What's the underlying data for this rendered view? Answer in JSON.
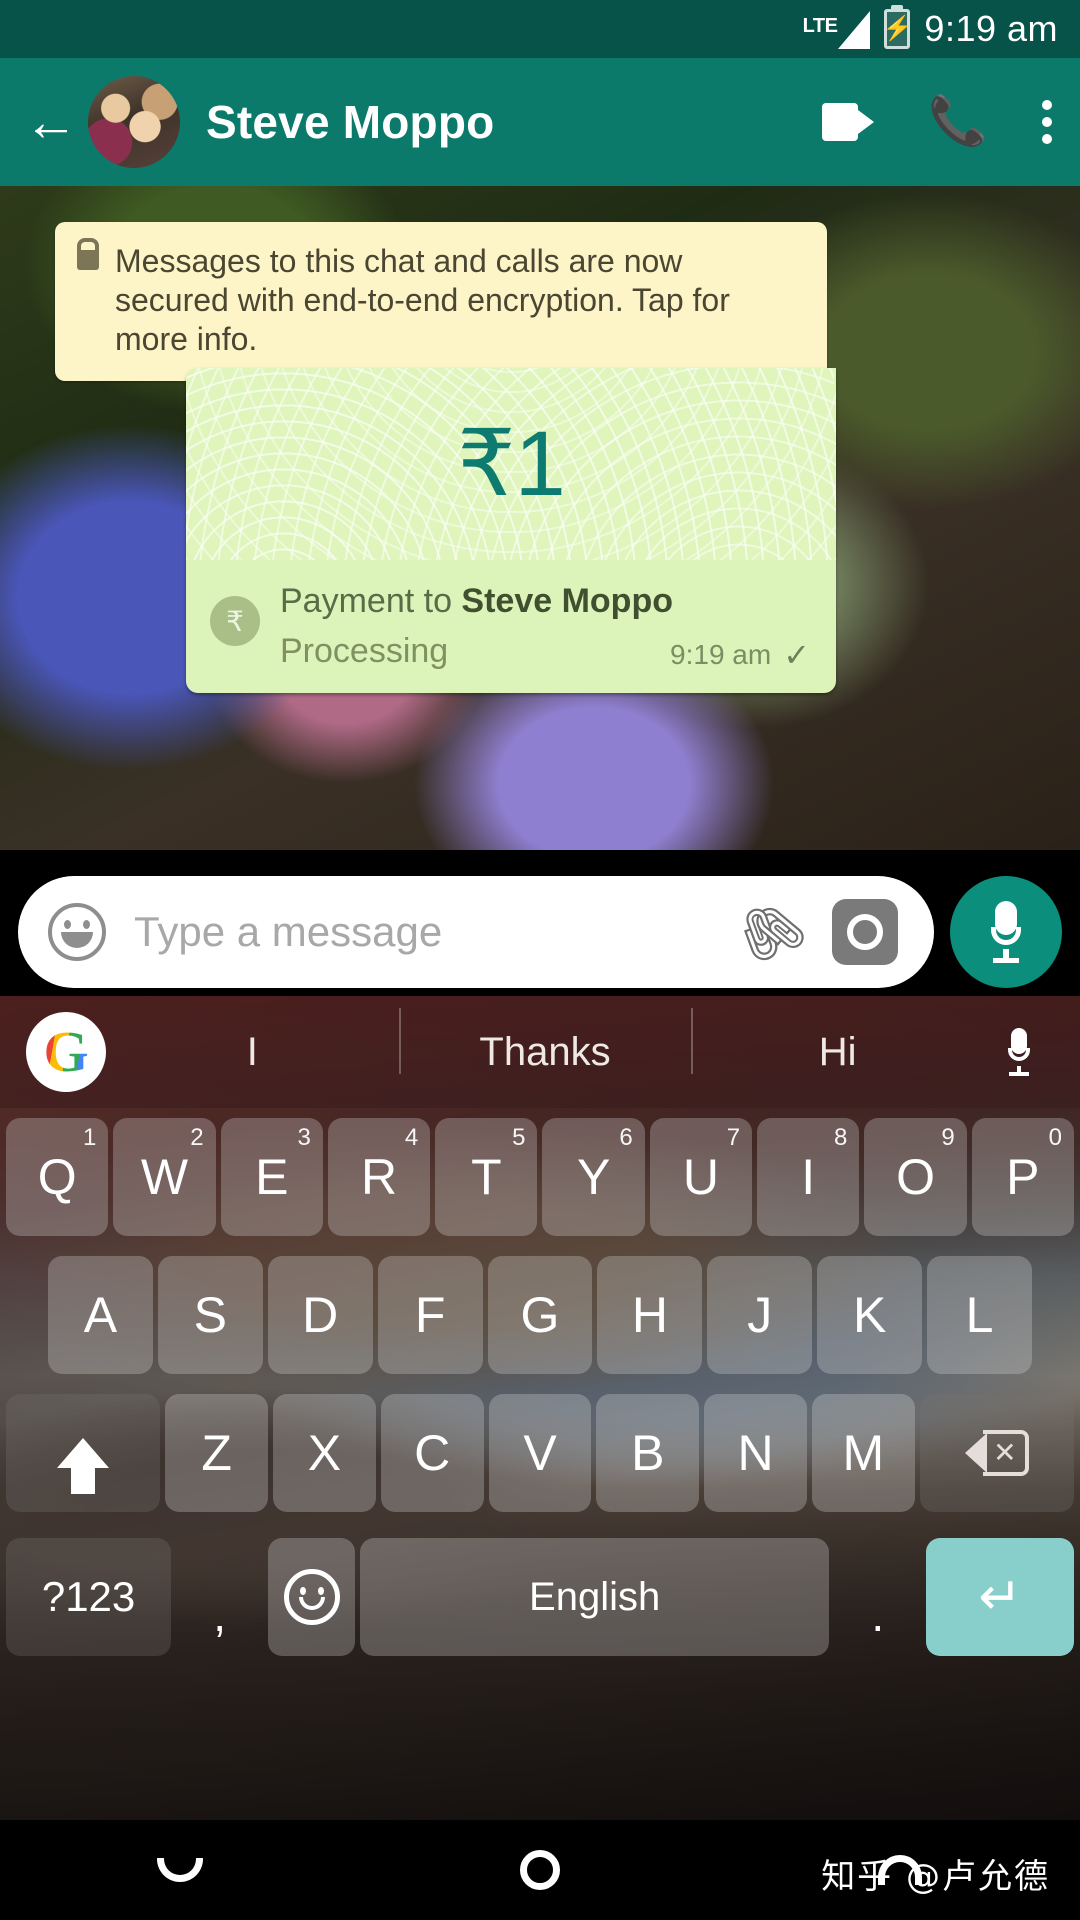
{
  "status_bar": {
    "network_label": "LTE",
    "signal_icon": "signal-bars-icon",
    "battery_icon": "battery-charging-icon",
    "time": "9:19 am"
  },
  "app_bar": {
    "back_icon": "back-arrow-icon",
    "avatar_alt": "contact-avatar",
    "contact_name": "Steve Moppo",
    "video_call_icon": "video-call-icon",
    "voice_call_icon": "phone-call-icon",
    "overflow_icon": "more-options-icon"
  },
  "chat": {
    "encryption_notice": {
      "lock_icon": "lock-icon",
      "text": "Messages to this chat and calls are now secured with end-to-end encryption. Tap for more info."
    },
    "payment_message": {
      "amount": "₹1",
      "currency_symbol": "₹",
      "value": "1",
      "badge_icon": "rupee-badge-icon",
      "title_prefix": "Payment to ",
      "recipient": "Steve Moppo",
      "status": "Processing",
      "timestamp": "9:19 am",
      "delivery_icon": "single-check-icon",
      "delivery_glyph": "✓",
      "accent_color": "#0d7b6f",
      "bubble_color": "#dcf4b9"
    }
  },
  "input_bar": {
    "emoji_icon": "emoji-icon",
    "placeholder": "Type a message",
    "value": "",
    "attach_icon": "paperclip-icon",
    "attach_glyph": "📎",
    "camera_icon": "camera-icon",
    "mic_icon": "microphone-icon"
  },
  "keyboard": {
    "suggestion_bar": {
      "logo_icon": "google-logo-icon",
      "logo_letter": "G",
      "suggestions": [
        "I",
        "Thanks",
        "Hi"
      ],
      "mic_icon": "voice-input-icon"
    },
    "row1": [
      {
        "label": "Q",
        "sup": "1"
      },
      {
        "label": "W",
        "sup": "2"
      },
      {
        "label": "E",
        "sup": "3"
      },
      {
        "label": "R",
        "sup": "4"
      },
      {
        "label": "T",
        "sup": "5"
      },
      {
        "label": "Y",
        "sup": "6"
      },
      {
        "label": "U",
        "sup": "7"
      },
      {
        "label": "I",
        "sup": "8"
      },
      {
        "label": "O",
        "sup": "9"
      },
      {
        "label": "P",
        "sup": "0"
      }
    ],
    "row2": [
      {
        "label": "A"
      },
      {
        "label": "S"
      },
      {
        "label": "D"
      },
      {
        "label": "F"
      },
      {
        "label": "G"
      },
      {
        "label": "H"
      },
      {
        "label": "J"
      },
      {
        "label": "K"
      },
      {
        "label": "L"
      }
    ],
    "row3": {
      "shift_icon": "shift-key-icon",
      "letters": [
        {
          "label": "Z"
        },
        {
          "label": "X"
        },
        {
          "label": "C"
        },
        {
          "label": "V"
        },
        {
          "label": "B"
        },
        {
          "label": "N"
        },
        {
          "label": "M"
        }
      ],
      "backspace_icon": "backspace-key-icon"
    },
    "row4": {
      "symbols_label": "?123",
      "comma_label": ",",
      "emoji_icon": "emoji-key-icon",
      "space_label": "English",
      "period_label": ".",
      "enter_icon": "enter-key-icon",
      "enter_glyph": "↵",
      "enter_color": "#88ceca"
    }
  },
  "nav_bar": {
    "back_icon": "nav-back-icon",
    "home_icon": "nav-home-icon",
    "recents_icon": "nav-recents-icon"
  },
  "watermark": {
    "text": "知乎 @卢允德"
  }
}
